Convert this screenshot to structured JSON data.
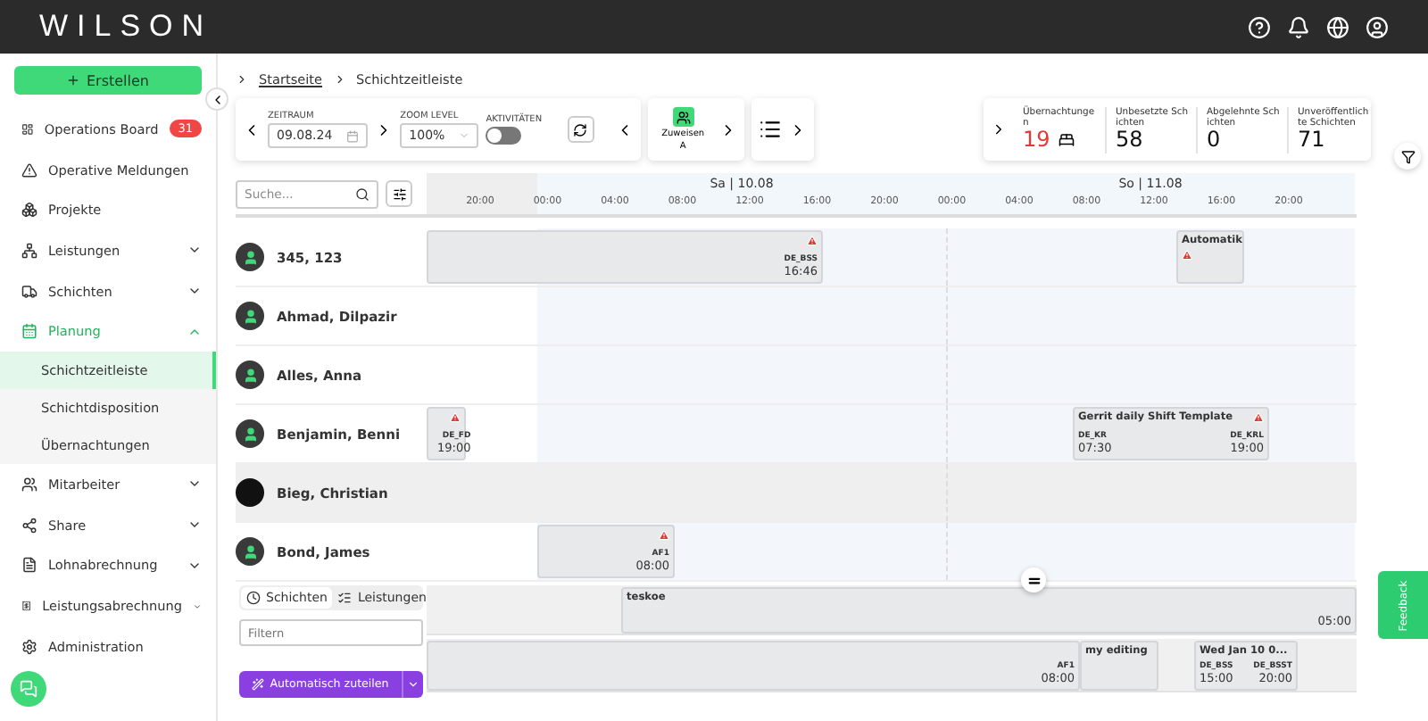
{
  "topbar": {
    "logo": "WILSON"
  },
  "sidebar": {
    "create_button": "Erstellen",
    "items": [
      {
        "label": "Operations Board",
        "kind": "link",
        "selected": false,
        "badge": "31"
      },
      {
        "label": "Operative Meldungen",
        "kind": "link",
        "selected": false
      },
      {
        "label": "Projekte",
        "kind": "link",
        "selected": false
      },
      {
        "label": "Leistungen",
        "kind": "group",
        "selected": false,
        "expanded": false
      },
      {
        "label": "Schichten",
        "kind": "group",
        "selected": false,
        "expanded": false
      },
      {
        "label": "Planung",
        "kind": "group",
        "selected": true,
        "expanded": true,
        "children": [
          {
            "label": "Schichtzeitleiste",
            "selected": true
          },
          {
            "label": "Schichtdisposition",
            "selected": false
          },
          {
            "label": "Übernachtungen",
            "selected": false
          }
        ]
      },
      {
        "label": "Mitarbeiter",
        "kind": "group",
        "selected": false,
        "expanded": false
      },
      {
        "label": "Share",
        "kind": "group",
        "selected": false,
        "expanded": false
      },
      {
        "label": "Lohnabrechnung",
        "kind": "group",
        "selected": false,
        "expanded": false
      },
      {
        "label": "Leistungsabrechnung",
        "kind": "group",
        "selected": false,
        "expanded": false
      },
      {
        "label": "Administration",
        "kind": "link",
        "selected": false
      }
    ]
  },
  "breadcrumb": [
    "Startseite",
    "Schichtzeitleiste"
  ],
  "toolbar": {
    "period_label": "ZEITRAUM",
    "period_value": "09.08.24",
    "zoom_label": "ZOOM LEVEL",
    "zoom_value": "100%",
    "activities_label": "AKTIVITÄTEN",
    "activities_on": false,
    "assign_button": "Zuweisen",
    "assign_sub": "A"
  },
  "stats": [
    {
      "label": "Übernachtungen",
      "value": "19",
      "color": "#e53935",
      "kind": "overnight"
    },
    {
      "label": "Unbesetzte Schichten",
      "value": "58",
      "color": "#111111",
      "kind": "plain"
    },
    {
      "label": "Abgelehnte Schichten",
      "value": "0",
      "color": "#111111",
      "kind": "plain"
    },
    {
      "label": "Unveröffentlichte Schichten",
      "value": "71",
      "color": "#111111",
      "kind": "plain"
    }
  ],
  "timeline": {
    "search_placeholder": "Suche...",
    "days": [
      "Sa | 10.08",
      "So | 11.08"
    ],
    "hours": [
      "20:00",
      "00:00",
      "04:00",
      "08:00",
      "12:00",
      "16:00",
      "20:00",
      "00:00",
      "04:00",
      "08:00",
      "12:00",
      "16:00",
      "20:00"
    ],
    "employees": [
      {
        "name": "345, 123",
        "kind": "default",
        "selected": false,
        "shifts": [
          {
            "end": {
              "code": "DE_BSS",
              "time": "16:46"
            },
            "warning": true
          },
          {
            "title": "Automatik",
            "warning": true
          }
        ]
      },
      {
        "name": "Ahmad, Dilpazir",
        "kind": "default",
        "selected": false
      },
      {
        "name": "Alles, Anna",
        "kind": "default",
        "selected": false
      },
      {
        "name": "Benjamin, Benni",
        "kind": "default",
        "selected": false,
        "shifts": [
          {
            "end": {
              "code": "DE_FD",
              "time": "19:00"
            },
            "warning": true
          },
          {
            "title": "Gerrit daily Shift Template",
            "start": {
              "code": "DE_KR",
              "time": "07:30"
            },
            "end": {
              "code": "DE_KRL",
              "time": "19:00"
            },
            "warning": true
          }
        ]
      },
      {
        "name": "Bieg, Christian",
        "kind": "image",
        "selected": true
      },
      {
        "name": "Bond, James",
        "kind": "default",
        "selected": false,
        "shifts": [
          {
            "end": {
              "code": "AF1",
              "time": "08:00"
            },
            "warning": true
          }
        ]
      }
    ],
    "panel_tabs": [
      {
        "label": "Schichten",
        "selected": true
      },
      {
        "label": "Leistungen",
        "selected": false
      }
    ],
    "filter_placeholder": "Filtern",
    "auto_button": "Automatisch zuteilen",
    "unassigned": [
      [
        {
          "title": "teskoe",
          "end": {
            "time": "05:00"
          },
          "warning": false
        }
      ],
      [
        {
          "end": {
            "code": "AF1",
            "time": "08:00"
          },
          "warning": false
        },
        {
          "title": "my editing",
          "warning": false
        },
        {
          "title": "Wed Jan 10 0...",
          "start": {
            "code": "DE_BSS",
            "time": "15:00"
          },
          "end": {
            "code": "DE_BSST",
            "time": "20:00"
          },
          "warning": false
        }
      ]
    ]
  },
  "feedback": "Feedback"
}
